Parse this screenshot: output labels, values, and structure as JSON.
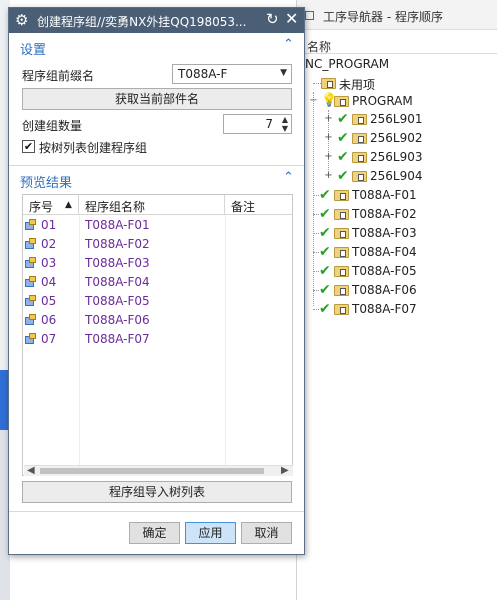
{
  "dialog": {
    "title": "创建程序组//奕勇NX外挂QQ198053...",
    "settings": {
      "section_title": "设置",
      "prefix_label": "程序组前缀名",
      "prefix_value": "T088A-F",
      "get_part_name_button": "获取当前部件名",
      "count_label": "创建组数量",
      "count_value": "7",
      "create_by_tree_label": "按树列表创建程序组",
      "create_by_tree_checked": true
    },
    "preview": {
      "section_title": "预览结果",
      "columns": [
        "序号",
        "程序组名称",
        "备注"
      ],
      "rows": [
        {
          "num": "01",
          "name": "T088A-F01",
          "note": ""
        },
        {
          "num": "02",
          "name": "T088A-F02",
          "note": ""
        },
        {
          "num": "03",
          "name": "T088A-F03",
          "note": ""
        },
        {
          "num": "04",
          "name": "T088A-F04",
          "note": ""
        },
        {
          "num": "05",
          "name": "T088A-F05",
          "note": ""
        },
        {
          "num": "06",
          "name": "T088A-F06",
          "note": ""
        },
        {
          "num": "07",
          "name": "T088A-F07",
          "note": ""
        }
      ],
      "import_button": "程序组导入树列表"
    },
    "footer": {
      "ok": "确定",
      "apply": "应用",
      "cancel": "取消"
    }
  },
  "navigator": {
    "title": "工序导航器 - 程序顺序",
    "column_header": "名称",
    "items": [
      {
        "label": "NC_PROGRAM"
      },
      {
        "label": "未用项"
      },
      {
        "label": "PROGRAM"
      },
      {
        "label": "256L901"
      },
      {
        "label": "256L902"
      },
      {
        "label": "256L903"
      },
      {
        "label": "256L904"
      },
      {
        "label": "T088A-F01"
      },
      {
        "label": "T088A-F02"
      },
      {
        "label": "T088A-F03"
      },
      {
        "label": "T088A-F04"
      },
      {
        "label": "T088A-F05"
      },
      {
        "label": "T088A-F06"
      },
      {
        "label": "T088A-F07"
      }
    ]
  },
  "colors": {
    "titlebar": "#4a5f76",
    "section_title": "#2f6fc0",
    "row_text": "#6b2c9a",
    "check": "#25a12b",
    "primary_button": "#cde3f7"
  }
}
